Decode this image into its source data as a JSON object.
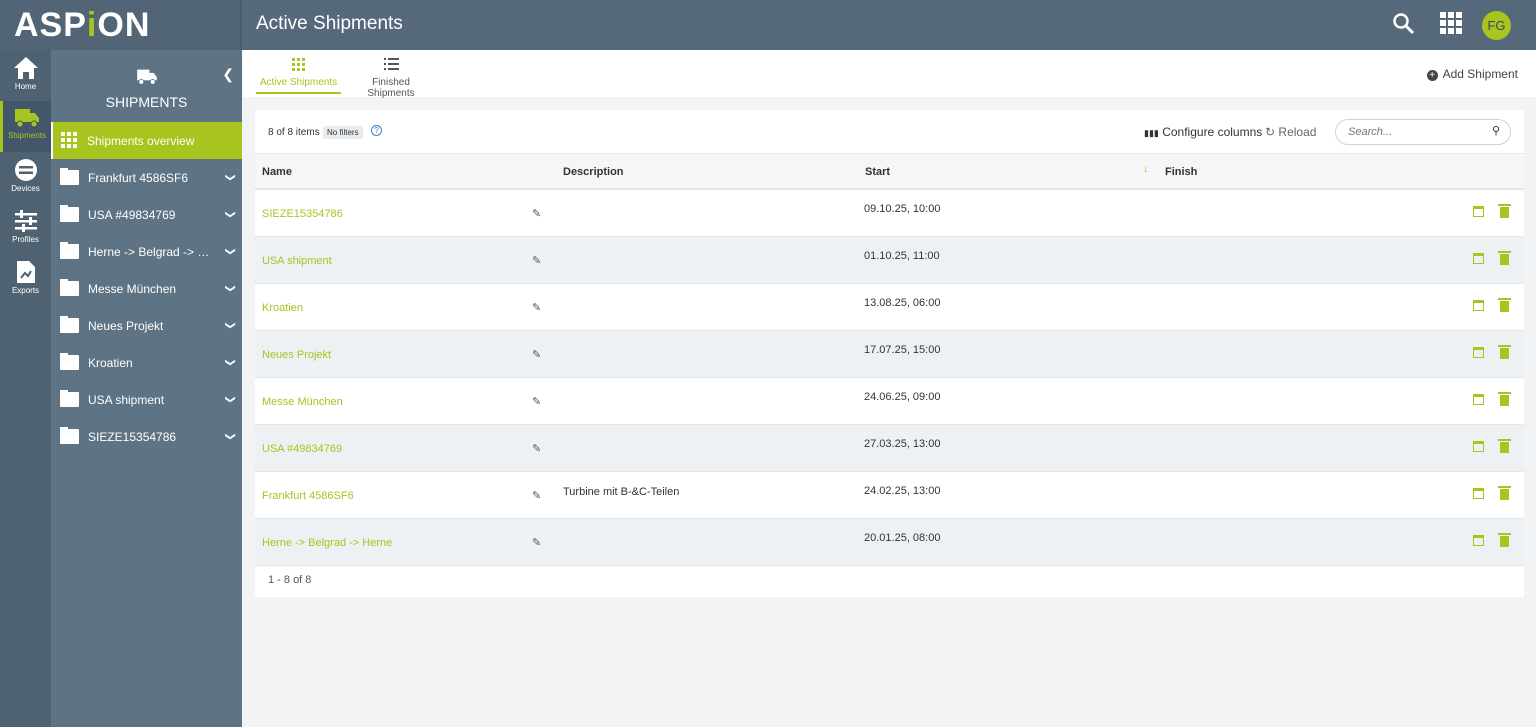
{
  "app": {
    "logo": "ASPiON",
    "page_title": "Active Shipments",
    "avatar_initials": "FG",
    "accent": "#a8c41e"
  },
  "rail": [
    {
      "label": "Home",
      "icon": "home-icon"
    },
    {
      "label": "Shipments",
      "icon": "truck-icon",
      "active": true
    },
    {
      "label": "Devices",
      "icon": "devices-icon"
    },
    {
      "label": "Profiles",
      "icon": "sliders-icon"
    },
    {
      "label": "Exports",
      "icon": "export-icon"
    }
  ],
  "nav": {
    "title": "SHIPMENTS",
    "overview": "Shipments overview",
    "folders": [
      "Frankfurt 4586SF6",
      "USA #49834769",
      "Herne -> Belgrad -> H...",
      "Messe München",
      "Neues Projekt",
      "Kroatien",
      "USA shipment",
      "SIEZE15354786"
    ]
  },
  "tabs": [
    {
      "label": "Active Shipments",
      "active": true
    },
    {
      "label": "Finished Shipments"
    }
  ],
  "add_label": "Add Shipment",
  "toolbar": {
    "count": "8 of 8 items",
    "filters": "No filters",
    "configure": "Configure columns",
    "reload": "Reload",
    "search_placeholder": "Search..."
  },
  "columns": {
    "name": "Name",
    "description": "Description",
    "start": "Start",
    "finish": "Finish"
  },
  "rows": [
    {
      "name": "SIEZE15354786",
      "description": "",
      "start": "09.10.25, 10:00",
      "finish": ""
    },
    {
      "name": "USA shipment",
      "description": "",
      "start": "01.10.25, 11:00",
      "finish": ""
    },
    {
      "name": "Kroatien",
      "description": "",
      "start": "13.08.25, 06:00",
      "finish": ""
    },
    {
      "name": "Neues Projekt",
      "description": "",
      "start": "17.07.25, 15:00",
      "finish": ""
    },
    {
      "name": "Messe München",
      "description": "",
      "start": "24.06.25, 09:00",
      "finish": ""
    },
    {
      "name": "USA #49834769",
      "description": "",
      "start": "27.03.25, 13:00",
      "finish": ""
    },
    {
      "name": "Frankfurt 4586SF6",
      "description": "Turbine mit B-&C-Teilen",
      "start": "24.02.25, 13:00",
      "finish": ""
    },
    {
      "name": "Herne -> Belgrad -> Herne",
      "description": "",
      "start": "20.01.25, 08:00",
      "finish": ""
    }
  ],
  "pagination": "1 - 8 of 8"
}
